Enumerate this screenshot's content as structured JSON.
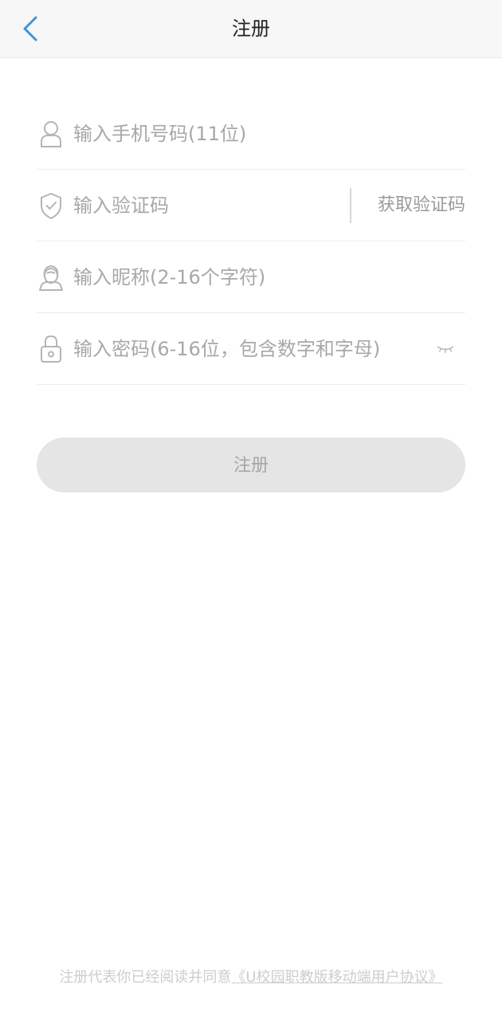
{
  "header": {
    "title": "注册",
    "back_icon": "chevron-left-icon",
    "accent_color": "#3a95db"
  },
  "form": {
    "phone": {
      "placeholder": "输入手机号码(11位)",
      "value": "",
      "icon": "user-icon"
    },
    "code": {
      "placeholder": "输入验证码",
      "value": "",
      "icon": "shield-check-icon",
      "get_code_label": "获取验证码"
    },
    "nickname": {
      "placeholder": "输入昵称(2-16个字符)",
      "value": "",
      "icon": "avatar-icon"
    },
    "password": {
      "placeholder": "输入密码(6-16位，包含数字和字母)",
      "value": "",
      "icon": "lock-icon",
      "toggle_icon": "eye-closed-icon"
    }
  },
  "submit": {
    "label": "注册",
    "disabled": true
  },
  "agreement": {
    "prefix": "注册代表你已经阅读并同意",
    "link_text": "《U校园职教版移动端用户协议》"
  }
}
